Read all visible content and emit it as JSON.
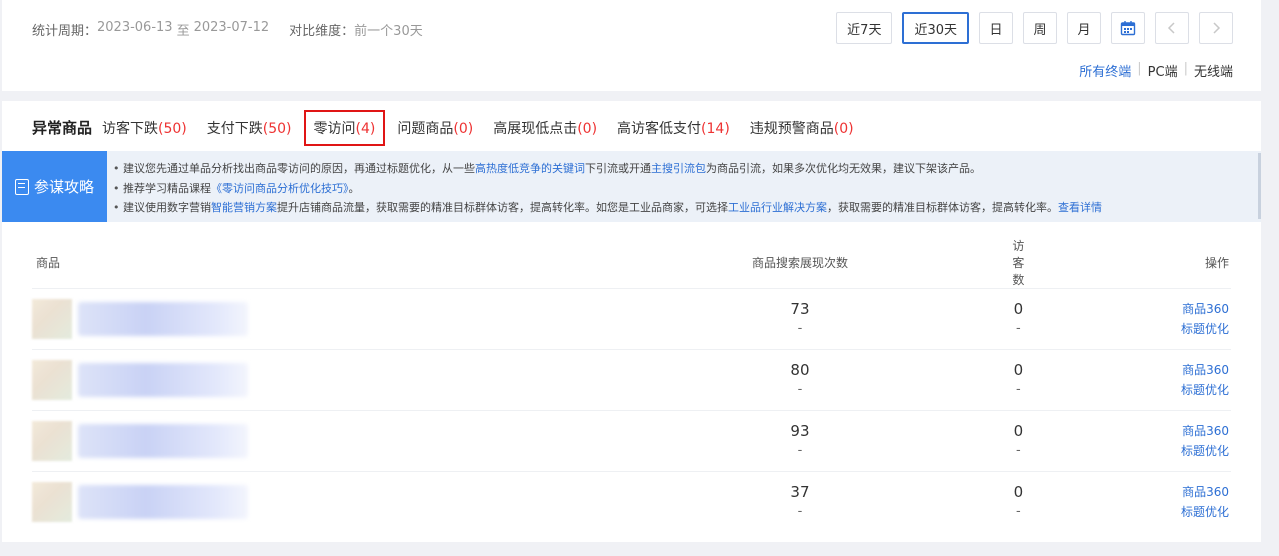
{
  "period": {
    "label": "统计周期：",
    "start": "2023-06-13",
    "sep": "至",
    "end": "2023-07-12",
    "compare_label": "对比维度：",
    "compare_value": "前一个30天"
  },
  "range_buttons": [
    "近7天",
    "近30天",
    "日",
    "周",
    "月"
  ],
  "active_range": "近30天",
  "icons": {
    "calendar": "calendar-icon",
    "prev": "chevron-left-icon",
    "next": "chevron-right-icon"
  },
  "terminals": [
    "所有终端",
    "PC端",
    "无线端"
  ],
  "active_terminal": "所有终端",
  "section_title": "异常商品",
  "tabs": [
    {
      "label": "访客下跌",
      "count": "(50)"
    },
    {
      "label": "支付下跌",
      "count": "(50)"
    },
    {
      "label": "零访问",
      "count": "(4)"
    },
    {
      "label": "问题商品",
      "count": "(0)"
    },
    {
      "label": "高展现低点击",
      "count": "(0)"
    },
    {
      "label": "高访客低支付",
      "count": "(14)"
    },
    {
      "label": "违规预警商品",
      "count": "(0)"
    }
  ],
  "selected_tab": "零访问",
  "tips": {
    "badge": "参谋攻略",
    "line1_a": "建议您先通过单品分析找出商品零访问的原因，再通过标题优化，从一些",
    "line1_link1": "高热度低竞争的关键词",
    "line1_b": "下引流或开通",
    "line1_link2": "主搜引流包",
    "line1_c": "为商品引流，如果多次优化均无效果，建议下架该产品。",
    "line2_a": "推荐学习精品课程",
    "line2_link": "《零访问商品分析优化技巧》",
    "line2_b": "。",
    "line3_a": "建议使用数字营销",
    "line3_link1": "智能营销方案",
    "line3_b": "提升店铺商品流量，获取需要的精准目标群体访客，提高转化率。如您是工业品商家，可选择",
    "line3_link2": "工业品行业解决方案",
    "line3_c": "，获取需要的精准目标群体访客，提高转化率。",
    "line3_link3": "查看详情"
  },
  "table": {
    "headers": [
      "商品",
      "商品搜索展现次数",
      "访客数",
      "操作"
    ],
    "rows": [
      {
        "impressions": "73",
        "impressions_sub": "-",
        "visitors": "0",
        "visitors_sub": "-"
      },
      {
        "impressions": "80",
        "impressions_sub": "-",
        "visitors": "0",
        "visitors_sub": "-"
      },
      {
        "impressions": "93",
        "impressions_sub": "-",
        "visitors": "0",
        "visitors_sub": "-"
      },
      {
        "impressions": "37",
        "impressions_sub": "-",
        "visitors": "0",
        "visitors_sub": "-"
      }
    ],
    "action1": "商品360",
    "action2": "标题优化"
  },
  "colors": {
    "accent": "#2d6fd4",
    "count_red": "#e33333",
    "selected_outline": "#e01515",
    "badge_blue": "#3b8af0"
  }
}
